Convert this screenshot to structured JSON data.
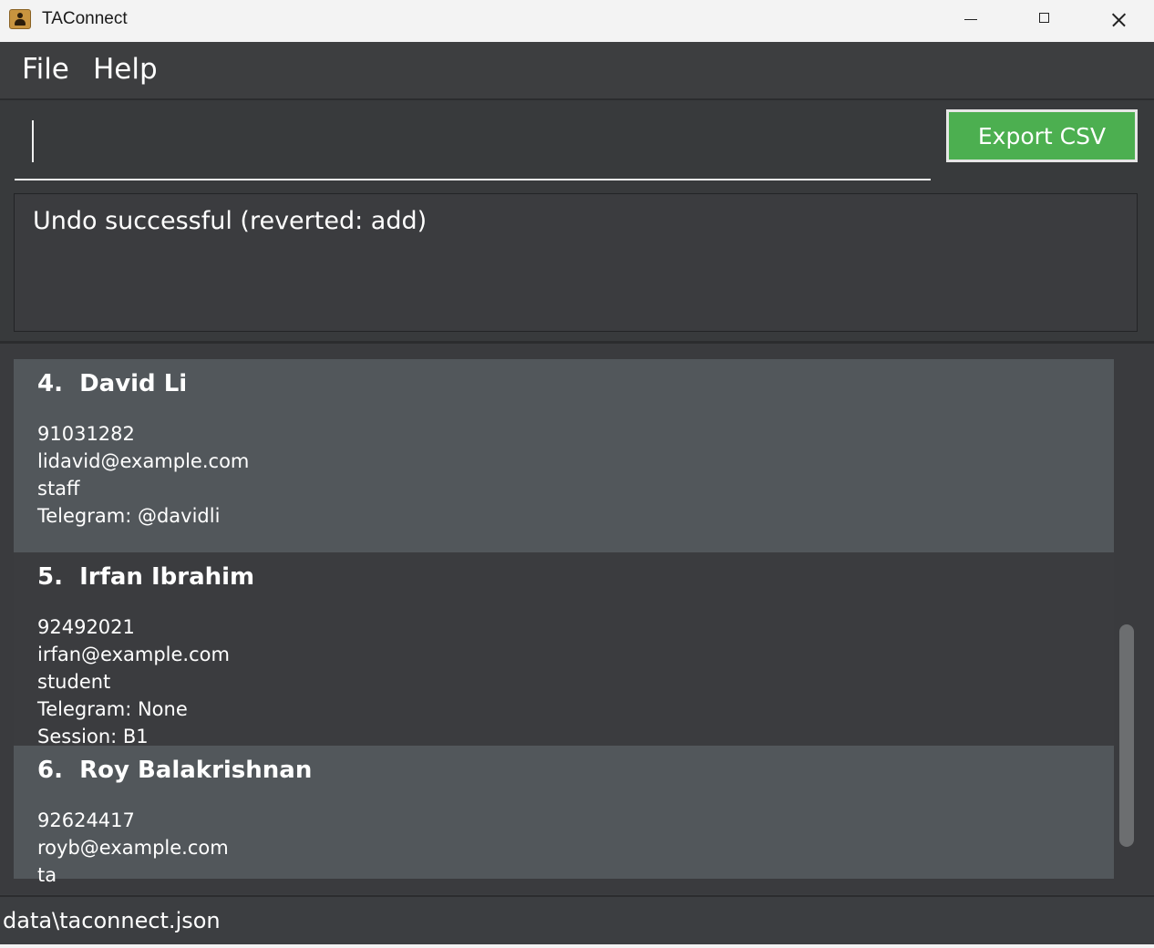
{
  "window": {
    "title": "TAConnect"
  },
  "menu": {
    "file": "File",
    "help": "Help"
  },
  "command": {
    "value": "",
    "export_label": "Export CSV"
  },
  "result": {
    "message": "Undo successful (reverted: add)"
  },
  "persons": [
    {
      "title": "4.  David Li",
      "phone": "91031282",
      "email": "lidavid@example.com",
      "role": "staff",
      "telegram": "Telegram: @davidli"
    },
    {
      "title": "5.  Irfan Ibrahim",
      "phone": "92492021",
      "email": "irfan@example.com",
      "role": "student",
      "telegram": "Telegram: None",
      "session": "Session: B1"
    },
    {
      "title": "6.  Roy Balakrishnan",
      "phone": "92624417",
      "email": "royb@example.com",
      "role": "ta"
    }
  ],
  "status": {
    "file_path": "data\\taconnect.json"
  },
  "colors": {
    "accent": "#4caf50",
    "background": "#3c3e41",
    "card_light": "#52575b",
    "card_dark": "#3b3c3f"
  },
  "icons": {
    "app": "address-book-icon",
    "minimize": "minimize-icon",
    "maximize": "maximize-icon",
    "close": "close-icon"
  }
}
